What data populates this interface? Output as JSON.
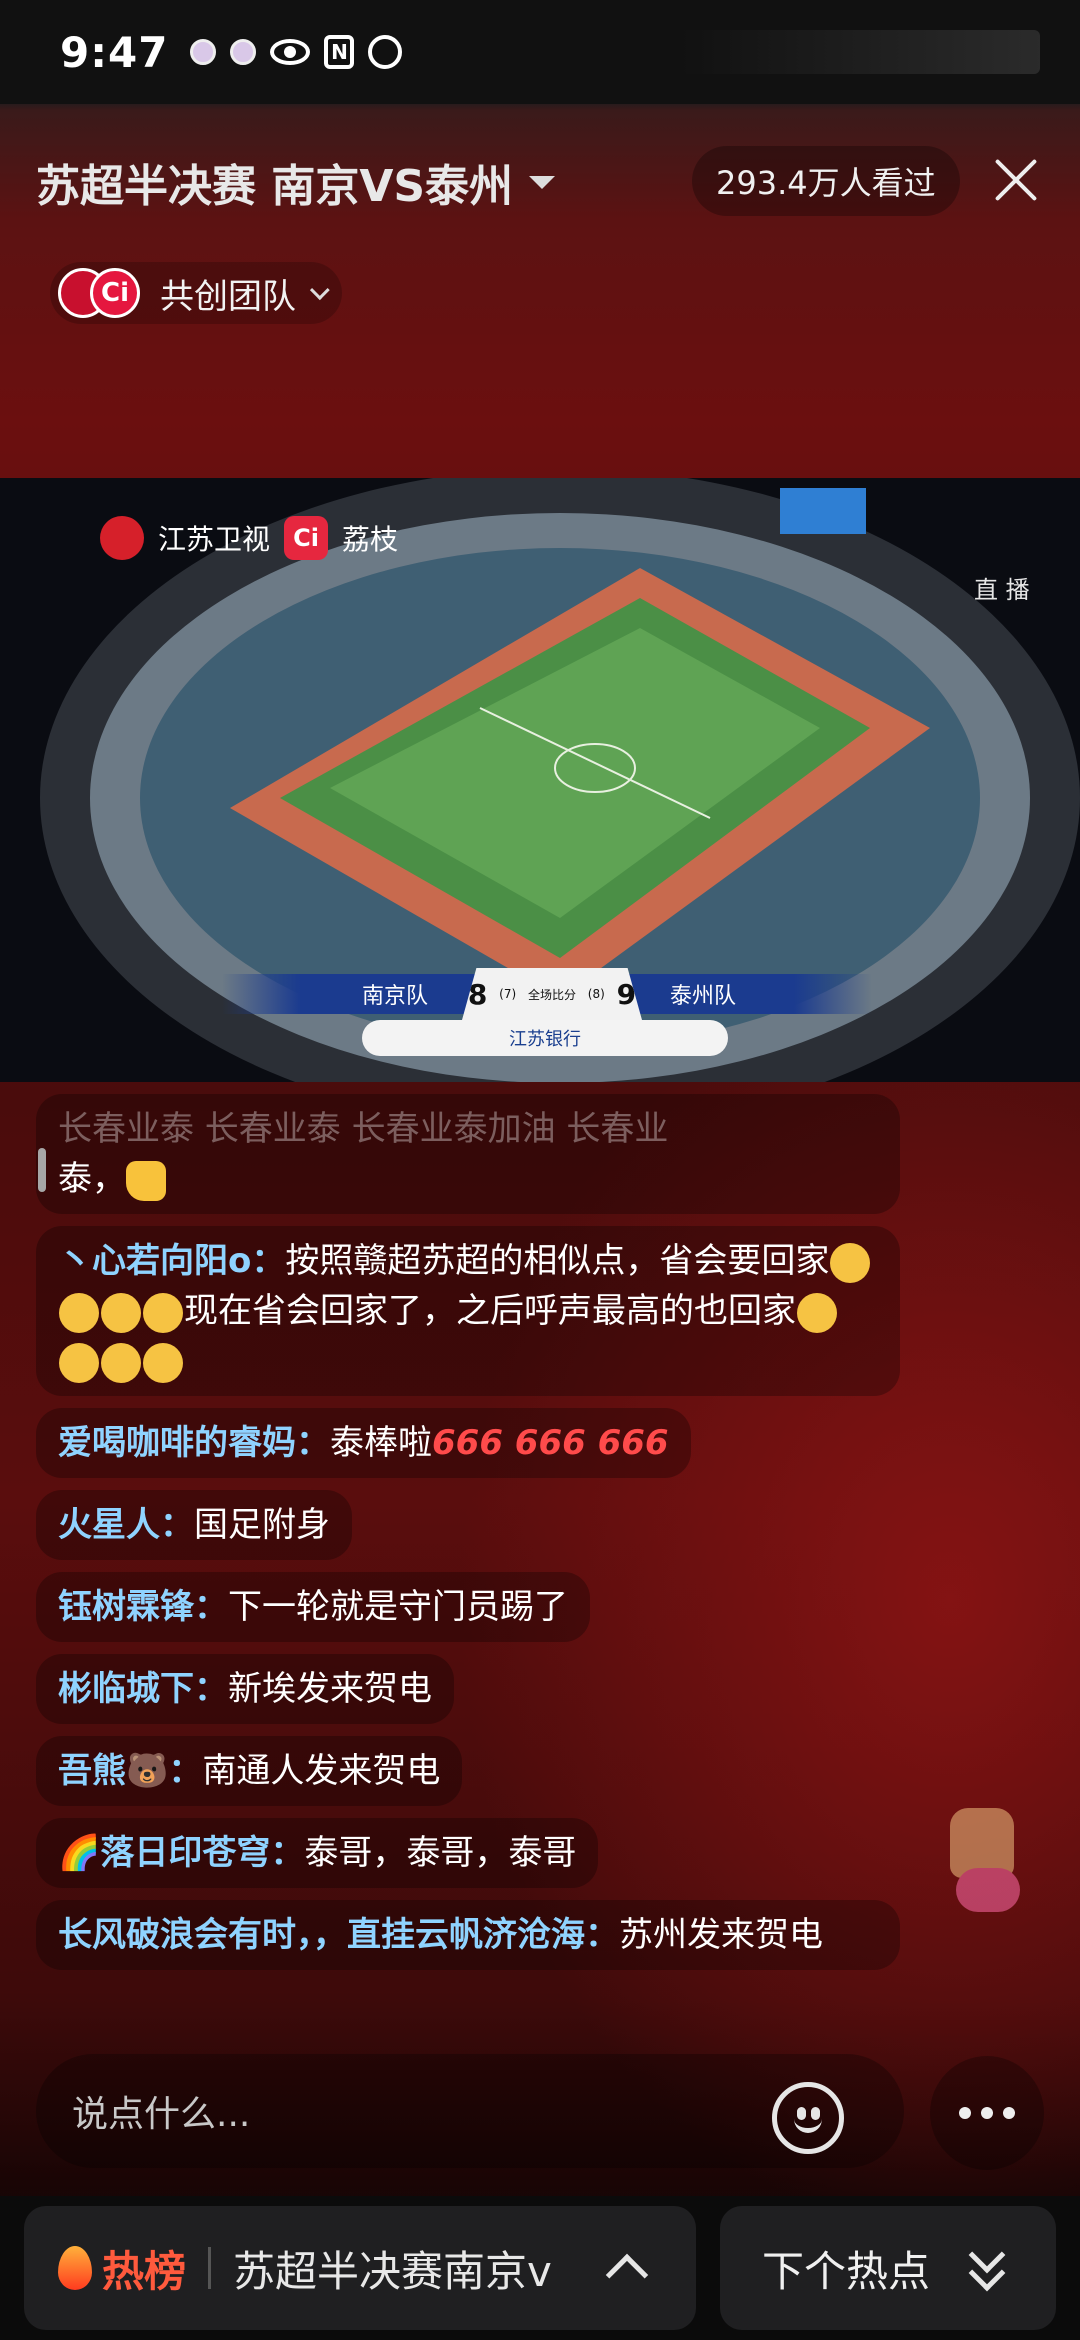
{
  "status_bar": {
    "time": "9:47"
  },
  "header": {
    "title": "苏超半决赛 南京VS泰州",
    "viewers": "293.4万人看过",
    "team_label": "共创团队"
  },
  "video": {
    "broadcaster_1": "江苏卫视",
    "broadcaster_2": "荔枝",
    "live_label": "直 播",
    "scoreboard": {
      "home_team": "南京队",
      "home_score": "8",
      "home_sub": "(7)",
      "caption": "全场比分",
      "away_sub": "(8)",
      "away_score": "9",
      "away_team": "泰州队"
    },
    "sponsor": "江苏银行"
  },
  "chat": {
    "m0_text": "长春业泰 长春业泰 长春业泰加油 长春业",
    "m0_tail": "泰，",
    "m1_user": "丶心若向阳o：",
    "m1_text_a": "按照赣超苏超的相似点，省会要回家",
    "m1_text_b": "现在省会回家了，之后呼声最高的也回家",
    "m2_user": "爱喝咖啡的睿妈：",
    "m2_text": "泰棒啦",
    "m2_suffix": "666 666 666",
    "m3_user": "火星人：",
    "m3_text": "国足附身",
    "m4_user": "钰树霖锋：",
    "m4_text": "下一轮就是守门员踢了",
    "m5_user": "彬临城下：",
    "m5_text": "新埃发来贺电",
    "m6_user": "吾熊🐻：",
    "m6_text": "南通人发来贺电",
    "m7_user": "🌈落日印苍穹：",
    "m7_text": "泰哥，泰哥，泰哥",
    "m8_user": "长风破浪会有时，，直挂云帆济沧海：",
    "m8_text": "苏州发来贺电"
  },
  "input": {
    "placeholder": "说点什么..."
  },
  "bottom_bar": {
    "hot_label": "热榜",
    "hot_text": "苏超半决赛南京vs",
    "next_label": "下个热点"
  },
  "colors": {
    "username": "#8fd3ff",
    "hot": "#ff5a3d"
  }
}
